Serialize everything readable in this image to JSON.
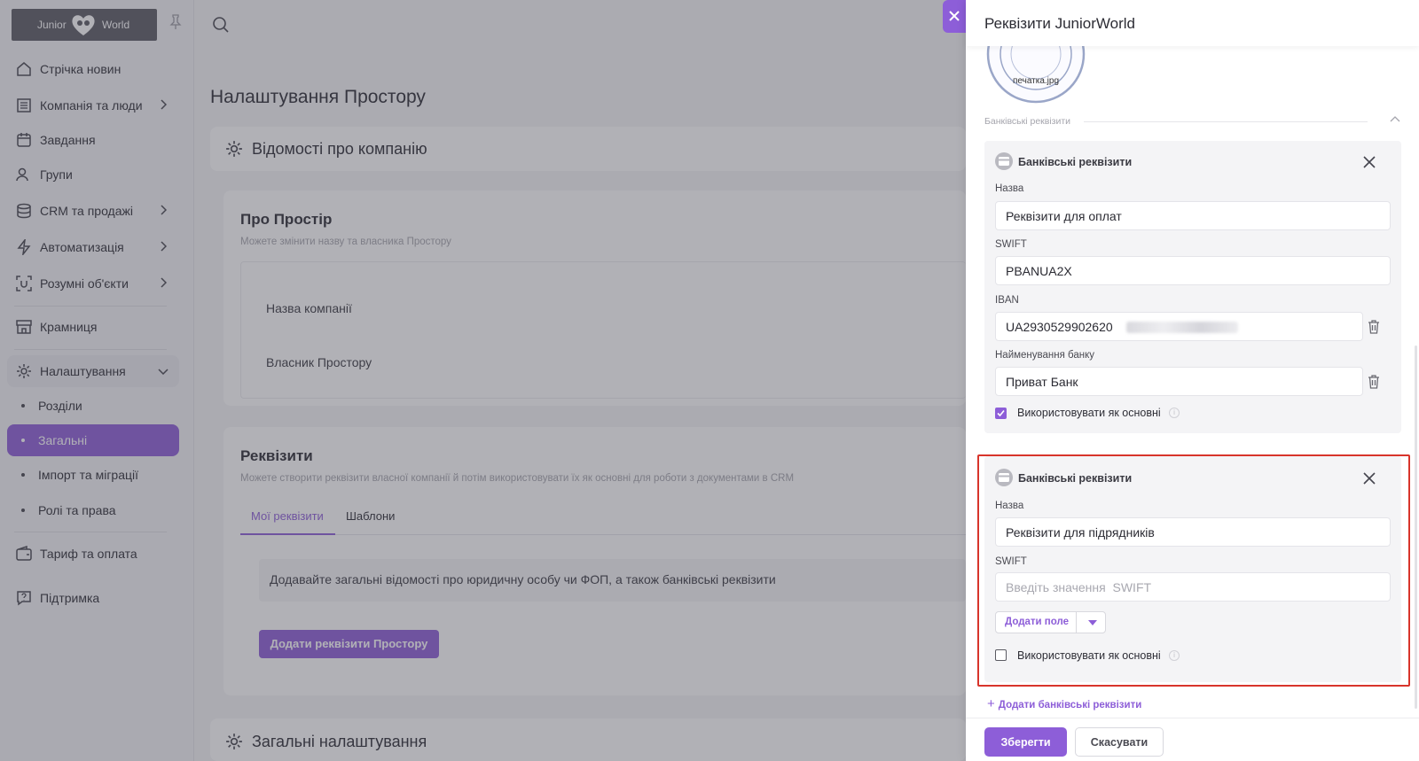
{
  "logo": {
    "left": "Junior",
    "right": "World"
  },
  "nav": {
    "news": "Стрічка новин",
    "companies": "Компанія та люди",
    "tasks": "Завдання",
    "groups": "Групи",
    "crm": "CRM та продажі",
    "automation": "Автоматизація",
    "smart_objects": "Розумні об'єкти",
    "shop": "Крамниця",
    "settings": "Налаштування",
    "sub": {
      "sections": "Розділи",
      "general": "Загальні",
      "import": "Імпорт та міграції",
      "roles": "Ролі та права"
    },
    "tariff": "Тариф та оплата",
    "support": "Підтримка"
  },
  "main": {
    "page_title": "Налаштування Простору",
    "company_card": {
      "title": "Відомості про компанію"
    },
    "about": {
      "title": "Про Простір",
      "hint": "Можете змінити назву та власника Простору",
      "company_name_label": "Назва компанії",
      "owner_label": "Власник Простору"
    },
    "requisites": {
      "title": "Реквізити",
      "hint": "Можете створити реквізити власної компанії й потім використовувати їх як основні для роботи з документами в CRM",
      "tab_mine": "Мої реквізити",
      "tab_templates": "Шаблони",
      "info": "Додавайте загальні відомості про юридичну особу чи ФОП, а також банківські реквізити",
      "add_button": "Додати реквізити Простору"
    },
    "general_settings": {
      "title": "Загальні налаштування"
    }
  },
  "drawer": {
    "title": "Реквізити JuniorWorld",
    "stamp_file": "печатка.jpg",
    "section_label": "Банківські реквізити",
    "bank1": {
      "head": "Банківські реквізити",
      "name_label": "Назва",
      "name_value": "Реквізити для оплат",
      "swift_label": "SWIFT",
      "swift_value": "PBANUA2X",
      "iban_label": "IBAN",
      "iban_value": "UA2930529902620",
      "bank_name_label": "Найменування банку",
      "bank_name_value": "Приват Банк",
      "use_default_label": "Використовувати як основні",
      "use_default_checked": true
    },
    "bank2": {
      "head": "Банківські реквізити",
      "name_label": "Назва",
      "name_value": "Реквізити для підрядників",
      "swift_label": "SWIFT",
      "swift_placeholder": "Введіть значення  SWIFT",
      "add_field": "Додати поле",
      "use_default_label": "Використовувати як основні",
      "use_default_checked": false
    },
    "add_bank": "Додати банківські реквізити",
    "save": "Зберегти",
    "cancel": "Скасувати"
  },
  "colors": {
    "accent": "#8d5ed8",
    "highlight": "#d8342b"
  }
}
